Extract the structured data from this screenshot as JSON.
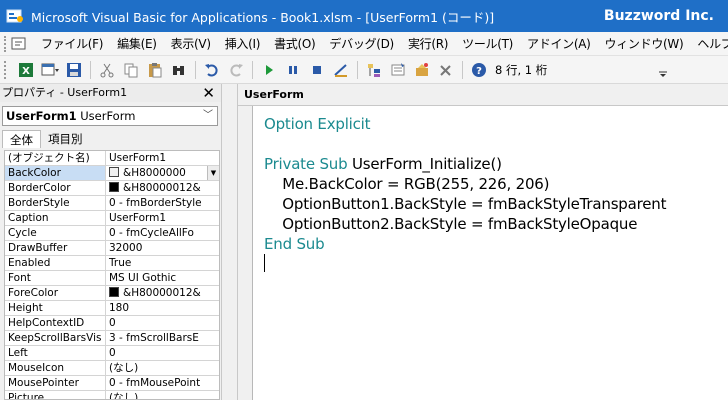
{
  "window": {
    "title": "Microsoft Visual Basic for Applications - Book1.xlsm - [UserForm1 (コード)]",
    "brand": "Buzzword Inc."
  },
  "menu": [
    "ファイル(F)",
    "編集(E)",
    "表示(V)",
    "挿入(I)",
    "書式(O)",
    "デバッグ(D)",
    "実行(R)",
    "ツール(T)",
    "アドイン(A)",
    "ウィンドウ(W)",
    "ヘルプ(H)"
  ],
  "toolbar": {
    "position_text": "8 行, 1 桁"
  },
  "properties": {
    "title": "プロパティ - UserForm1",
    "object_name": "UserForm1",
    "object_type": "UserForm",
    "tabs": [
      "全体",
      "項目別"
    ],
    "rows": [
      {
        "key": "(オブジェクト名)",
        "value": "UserForm1"
      },
      {
        "key": "BackColor",
        "value": "&H8000000"
      },
      {
        "key": "BorderColor",
        "value": "&H80000012&"
      },
      {
        "key": "BorderStyle",
        "value": "0 - fmBorderStyle"
      },
      {
        "key": "Caption",
        "value": "UserForm1"
      },
      {
        "key": "Cycle",
        "value": "0 - fmCycleAllFo"
      },
      {
        "key": "DrawBuffer",
        "value": "32000"
      },
      {
        "key": "Enabled",
        "value": "True"
      },
      {
        "key": "Font",
        "value": "MS UI Gothic"
      },
      {
        "key": "ForeColor",
        "value": "&H80000012&"
      },
      {
        "key": "Height",
        "value": "180"
      },
      {
        "key": "HelpContextID",
        "value": "0"
      },
      {
        "key": "KeepScrollBarsVis",
        "value": "3 - fmScrollBarsE"
      },
      {
        "key": "Left",
        "value": "0"
      },
      {
        "key": "MouseIcon",
        "value": "(なし)"
      },
      {
        "key": "MousePointer",
        "value": "0 - fmMousePoint"
      },
      {
        "key": "Picture",
        "value": "(なし)"
      }
    ]
  },
  "code_window": {
    "title": "UserForm",
    "lines": [
      [
        {
          "t": "Option Explicit",
          "c": "kw"
        }
      ],
      [],
      [
        {
          "t": "Private Sub",
          "c": "kw"
        },
        {
          "t": " UserForm_Initialize()",
          "c": ""
        }
      ],
      [
        {
          "t": "    Me.BackColor = RGB(255, 226, 206)",
          "c": ""
        }
      ],
      [
        {
          "t": "    OptionButton1.BackStyle = fmBackStyleTransparent",
          "c": ""
        }
      ],
      [
        {
          "t": "    OptionButton2.BackStyle = fmBackStyleOpaque",
          "c": ""
        }
      ],
      [
        {
          "t": "End Sub",
          "c": "kw"
        }
      ]
    ]
  },
  "colors": {
    "titlebar": "#1f6fc7",
    "keyword": "#1b8a8f"
  }
}
